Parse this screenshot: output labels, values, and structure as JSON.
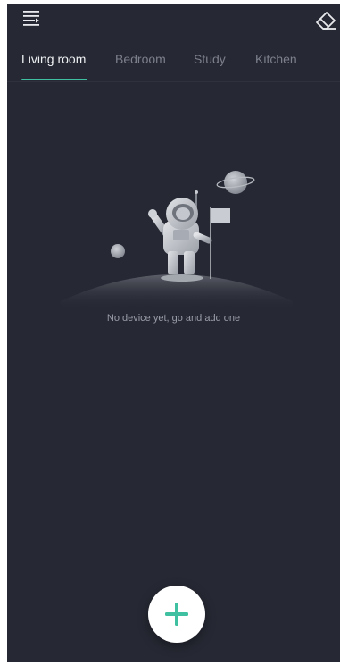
{
  "tabs": [
    {
      "label": "Living room",
      "active": true
    },
    {
      "label": "Bedroom",
      "active": false
    },
    {
      "label": "Study",
      "active": false
    },
    {
      "label": "Kitchen",
      "active": false
    }
  ],
  "empty_state": {
    "message": "No device yet, go and add one"
  },
  "icons": {
    "menu": "menu-icon",
    "eraser": "eraser-icon",
    "add": "plus-icon"
  },
  "colors": {
    "background": "#262833",
    "accent": "#3fc0a0",
    "tab_active": "#eef0f3",
    "tab_inactive": "#7c808c"
  }
}
